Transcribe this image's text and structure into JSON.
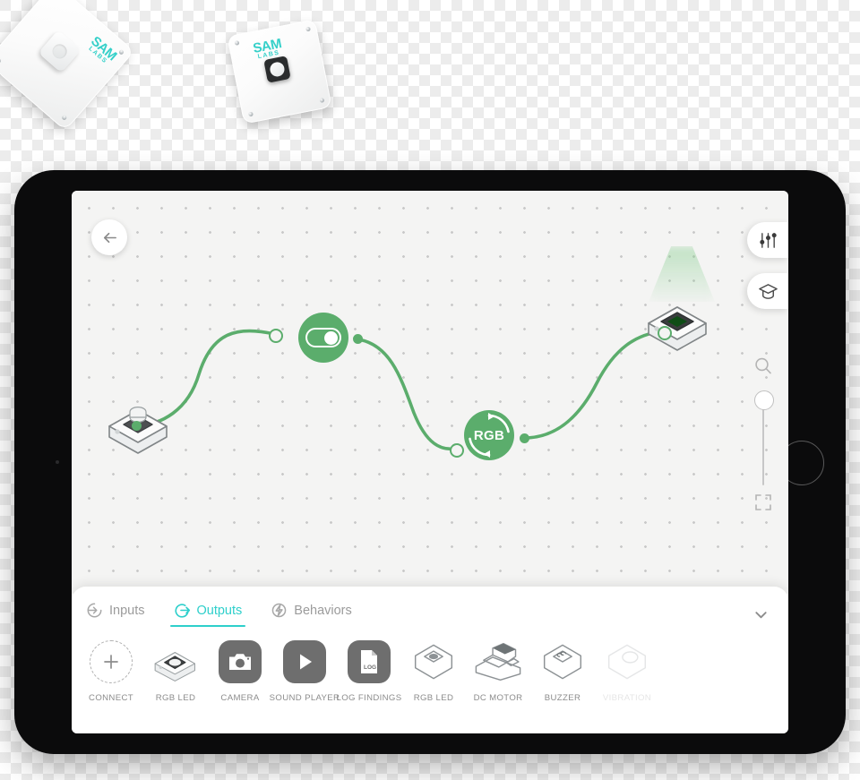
{
  "hardware_blocks": [
    {
      "name": "sam-labs-button-block",
      "logo_top": "SAM",
      "logo_bottom": "LABS"
    },
    {
      "name": "sam-labs-led-block",
      "logo_top": "SAM",
      "logo_bottom": "LABS"
    }
  ],
  "canvas": {
    "back_button": "back-arrow-icon",
    "settings_button": "sliders-icon",
    "learn_button": "graduation-cap-icon",
    "zoom_search": "magnifier-icon",
    "fit_screen": "fit-screen-icon",
    "zoom_slider_value": 100,
    "nodes": [
      {
        "id": "button-input",
        "type": "hardware-button",
        "label": ""
      },
      {
        "id": "toggle-behavior",
        "type": "toggle",
        "label": "",
        "state": "on"
      },
      {
        "id": "rgb-behavior",
        "type": "rgb",
        "label": "RGB"
      },
      {
        "id": "rgb-led-output",
        "type": "hardware-rgb-led",
        "label": "",
        "glow": "#7ac884"
      }
    ],
    "connections": [
      {
        "from": "button-input",
        "to": "toggle-behavior"
      },
      {
        "from": "toggle-behavior",
        "to": "rgb-behavior"
      },
      {
        "from": "rgb-behavior",
        "to": "rgb-led-output"
      }
    ]
  },
  "tray": {
    "collapse_icon": "chevron-down-icon",
    "tabs": [
      {
        "label": "Inputs",
        "icon": "arrow-into-circle-icon",
        "active": false
      },
      {
        "label": "Outputs",
        "icon": "arrow-out-circle-icon",
        "active": true
      },
      {
        "label": "Behaviors",
        "icon": "lightning-bolt-icon",
        "active": false
      }
    ],
    "items": [
      {
        "label": "CONNECT",
        "icon": "plus-dashed-icon",
        "style": "dashed",
        "faded": false
      },
      {
        "label": "RGB LED",
        "icon": "rgb-led-block-icon",
        "style": "photo",
        "faded": false
      },
      {
        "label": "CAMERA",
        "icon": "camera-icon",
        "style": "square",
        "faded": false
      },
      {
        "label": "SOUND PLAYER",
        "icon": "play-icon",
        "style": "square",
        "faded": false
      },
      {
        "label": "LOG FINDINGS",
        "icon": "log-document-icon",
        "style": "square",
        "faded": false
      },
      {
        "label": "RGB LED",
        "icon": "rgb-led-outline-icon",
        "style": "outline",
        "faded": false
      },
      {
        "label": "DC MOTOR",
        "icon": "dc-motor-icon",
        "style": "outline",
        "faded": false
      },
      {
        "label": "BUZZER",
        "icon": "buzzer-icon",
        "style": "outline",
        "faded": false
      },
      {
        "label": "VIBRATION",
        "icon": "vibration-icon",
        "style": "outline",
        "faded": true
      }
    ]
  },
  "colors": {
    "accent_teal": "#2ECFCB",
    "node_green": "#5BAD6C",
    "brand_logo": "#35D0C9",
    "icon_gray": "#6e6e6e",
    "canvas_bg": "#f4f4f3"
  }
}
